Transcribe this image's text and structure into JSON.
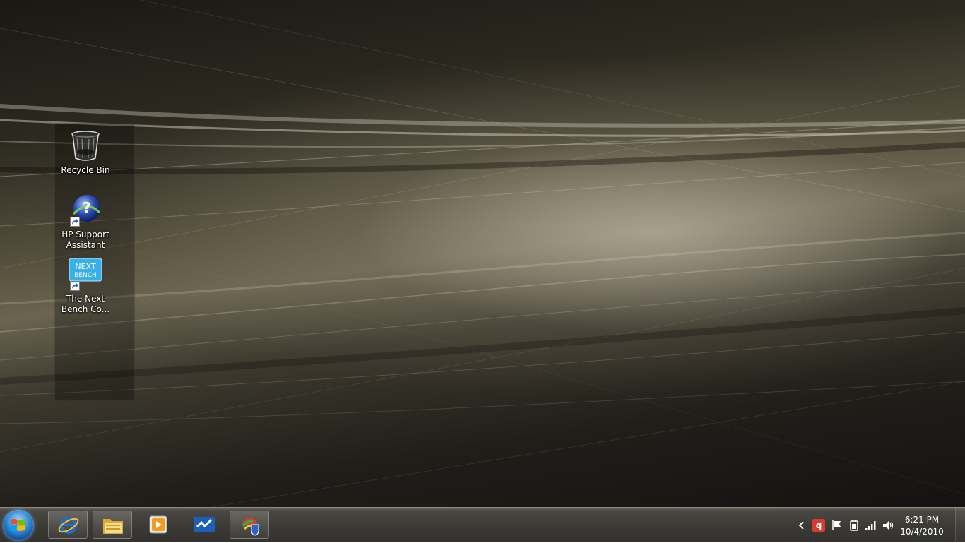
{
  "desktop": {
    "icons": [
      {
        "label": "Recycle Bin",
        "icon": "recycle-bin-icon",
        "shortcut": false
      },
      {
        "label": "HP Support\nAssistant",
        "icon": "hp-support-assistant-icon",
        "shortcut": true
      },
      {
        "label": "The Next\nBench Co...",
        "icon": "next-bench-icon",
        "shortcut": true,
        "logo_text": "NEXT BENCH"
      }
    ]
  },
  "taskbar": {
    "start": {
      "icon": "windows-start-icon"
    },
    "pinned": [
      {
        "name": "Internet Explorer",
        "icon": "internet-explorer-icon"
      },
      {
        "name": "Windows Explorer",
        "icon": "folder-icon"
      },
      {
        "name": "Windows Media Player",
        "icon": "media-player-icon"
      },
      {
        "name": "HP QuickWeb",
        "icon": "checkmark-app-icon"
      },
      {
        "name": "Security",
        "icon": "security-shield-icon"
      }
    ],
    "tray": {
      "icons": [
        "chevron-left-icon",
        "quickbooks-icon",
        "flag-icon",
        "power-icon",
        "signal-icon",
        "volume-icon"
      ],
      "time": "6:21 PM",
      "date": "10/4/2010"
    }
  },
  "colors": {
    "accent_ie": "#1c6fd1",
    "folder": "#e8c35a",
    "media_orange": "#f39c1e",
    "tray_red": "#d93a2c"
  }
}
